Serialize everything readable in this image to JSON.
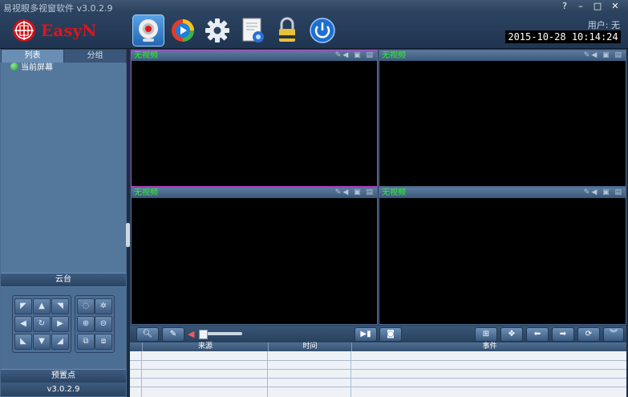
{
  "window": {
    "title": "易视眼多视窗软件 v3.0.2.9",
    "help_label": "?",
    "minimize_label": "–",
    "maximize_label": "□",
    "close_label": "✕"
  },
  "header": {
    "logo_text": "EasyN",
    "user_label": "用户: 无",
    "clock": "2015-10-28  10:14:24",
    "toolbar": [
      {
        "icon": "camera-preview-icon",
        "active": true
      },
      {
        "icon": "playback-icon"
      },
      {
        "icon": "settings-gear-icon"
      },
      {
        "icon": "log-document-icon"
      },
      {
        "icon": "lock-icon"
      },
      {
        "icon": "power-icon"
      }
    ]
  },
  "sidebar": {
    "tabs": [
      "列表",
      "分组"
    ],
    "tree": [
      {
        "label": "当前屏幕",
        "icon": "globe-icon"
      }
    ],
    "ptz_title": "云台",
    "preset_title": "预置点",
    "version": "v3.0.2.9"
  },
  "video": {
    "panes": [
      {
        "label": "无视频",
        "selected": true
      },
      {
        "label": "无视频"
      },
      {
        "label": "无视频"
      },
      {
        "label": "无视频"
      }
    ]
  },
  "events": {
    "columns": [
      "来源",
      "时间",
      "事件"
    ]
  },
  "colors": {
    "video_label": "#2ef02e",
    "selected_border": "#c43ad0",
    "panel_bg": "#4a6b8f"
  }
}
